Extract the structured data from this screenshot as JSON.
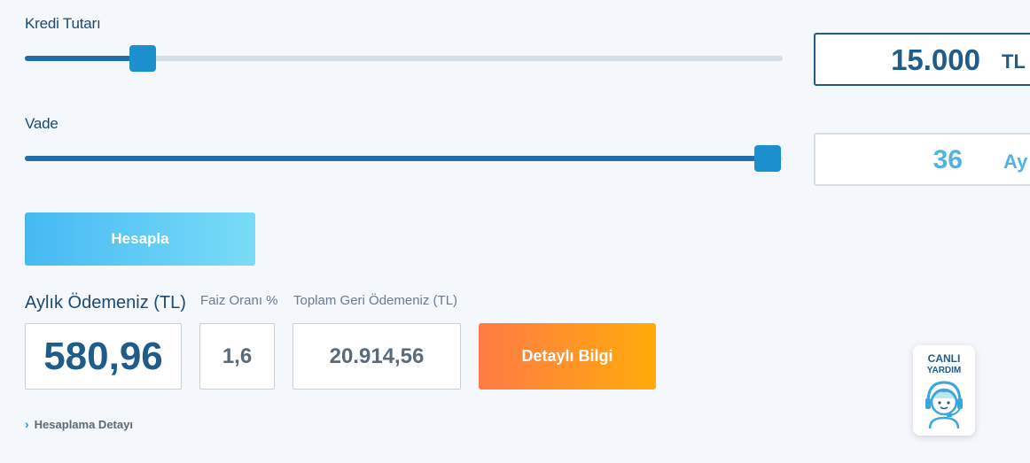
{
  "loan": {
    "label": "Kredi Tutarı",
    "value": "15.000",
    "unit": "TL",
    "slider_fraction": 0.155
  },
  "term": {
    "label": "Vade",
    "value": "36",
    "unit": "Ay",
    "slider_fraction": 0.98
  },
  "calculate_button": "Hesapla",
  "results": {
    "monthly_label": "Aylık Ödemeniz (TL)",
    "monthly_value": "580,96",
    "rate_label": "Faiz Oranı %",
    "rate_value": "1,6",
    "total_label": "Toplam Geri Ödemeniz (TL)",
    "total_value": "20.914,56"
  },
  "detail_button": "Detaylı Bilgi",
  "calc_detail_link": "Hesaplama Detayı",
  "live_help": {
    "line1": "CANLI",
    "line2": "YARDIM",
    "icon": "support-agent-icon"
  },
  "colors": {
    "primary": "#1f5c8a",
    "slider_thumb": "#1c8fcf",
    "calc_gradient_start": "#46b9f3",
    "detail_gradient_start": "#ff7a45",
    "detail_gradient_end": "#ffab0a"
  }
}
